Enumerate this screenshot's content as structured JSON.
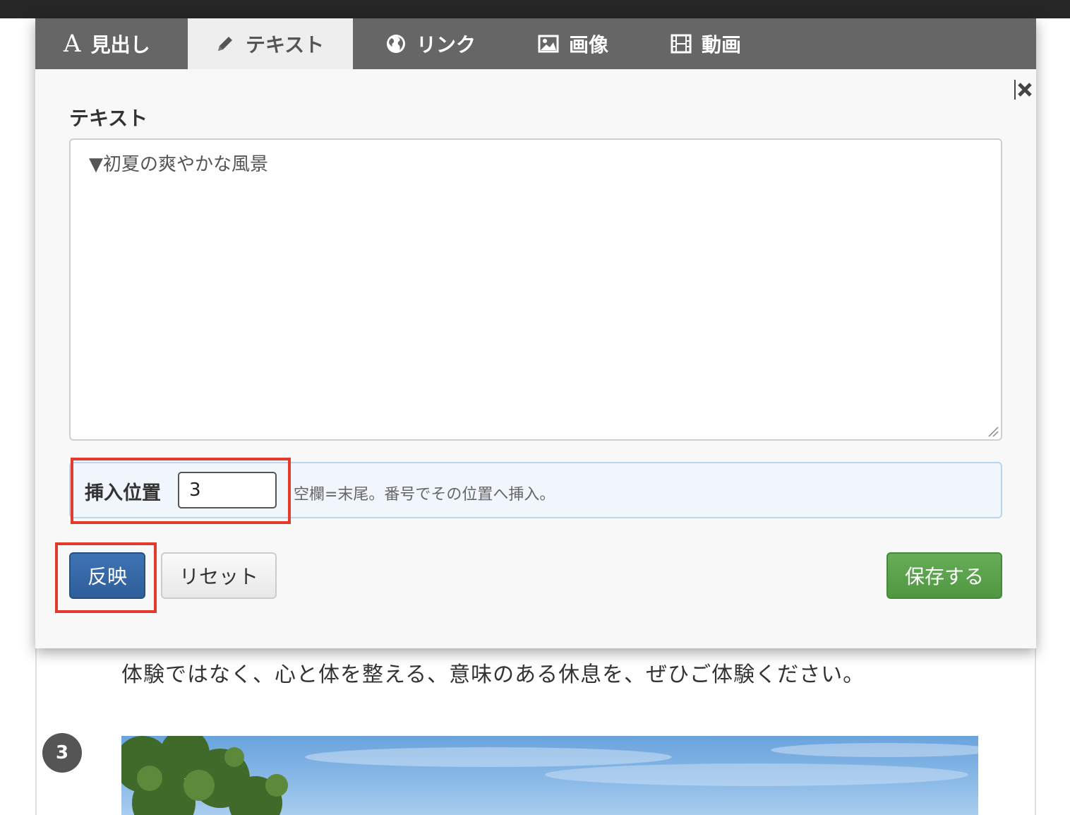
{
  "background": {
    "paragraph_text": "体験ではなく、心と体を整える、意味のある休息を、ぜひご体験ください。",
    "step_number": "3"
  },
  "tabs": [
    {
      "label": "見出し",
      "icon": "letter-a-icon",
      "icon_glyph": "A",
      "active": false
    },
    {
      "label": "テキスト",
      "icon": "pencil-icon",
      "active": true
    },
    {
      "label": "リンク",
      "icon": "globe-icon",
      "active": false
    },
    {
      "label": "画像",
      "icon": "picture-icon",
      "active": false
    },
    {
      "label": "動画",
      "icon": "film-icon",
      "active": false
    }
  ],
  "editor": {
    "section_label": "テキスト",
    "text_value": "▼初夏の爽やかな風景"
  },
  "insert": {
    "label": "挿入位置",
    "value": "3",
    "help": "空欄=末尾。番号でその位置へ挿入。"
  },
  "buttons": {
    "apply": "反映",
    "reset": "リセット",
    "save": "保存する"
  },
  "colors": {
    "tab_bar": "#666666",
    "active_tab": "#eeeeee",
    "apply_button": "#3e73b4",
    "save_button": "#5ba24c",
    "highlight": "#e23b2e"
  }
}
